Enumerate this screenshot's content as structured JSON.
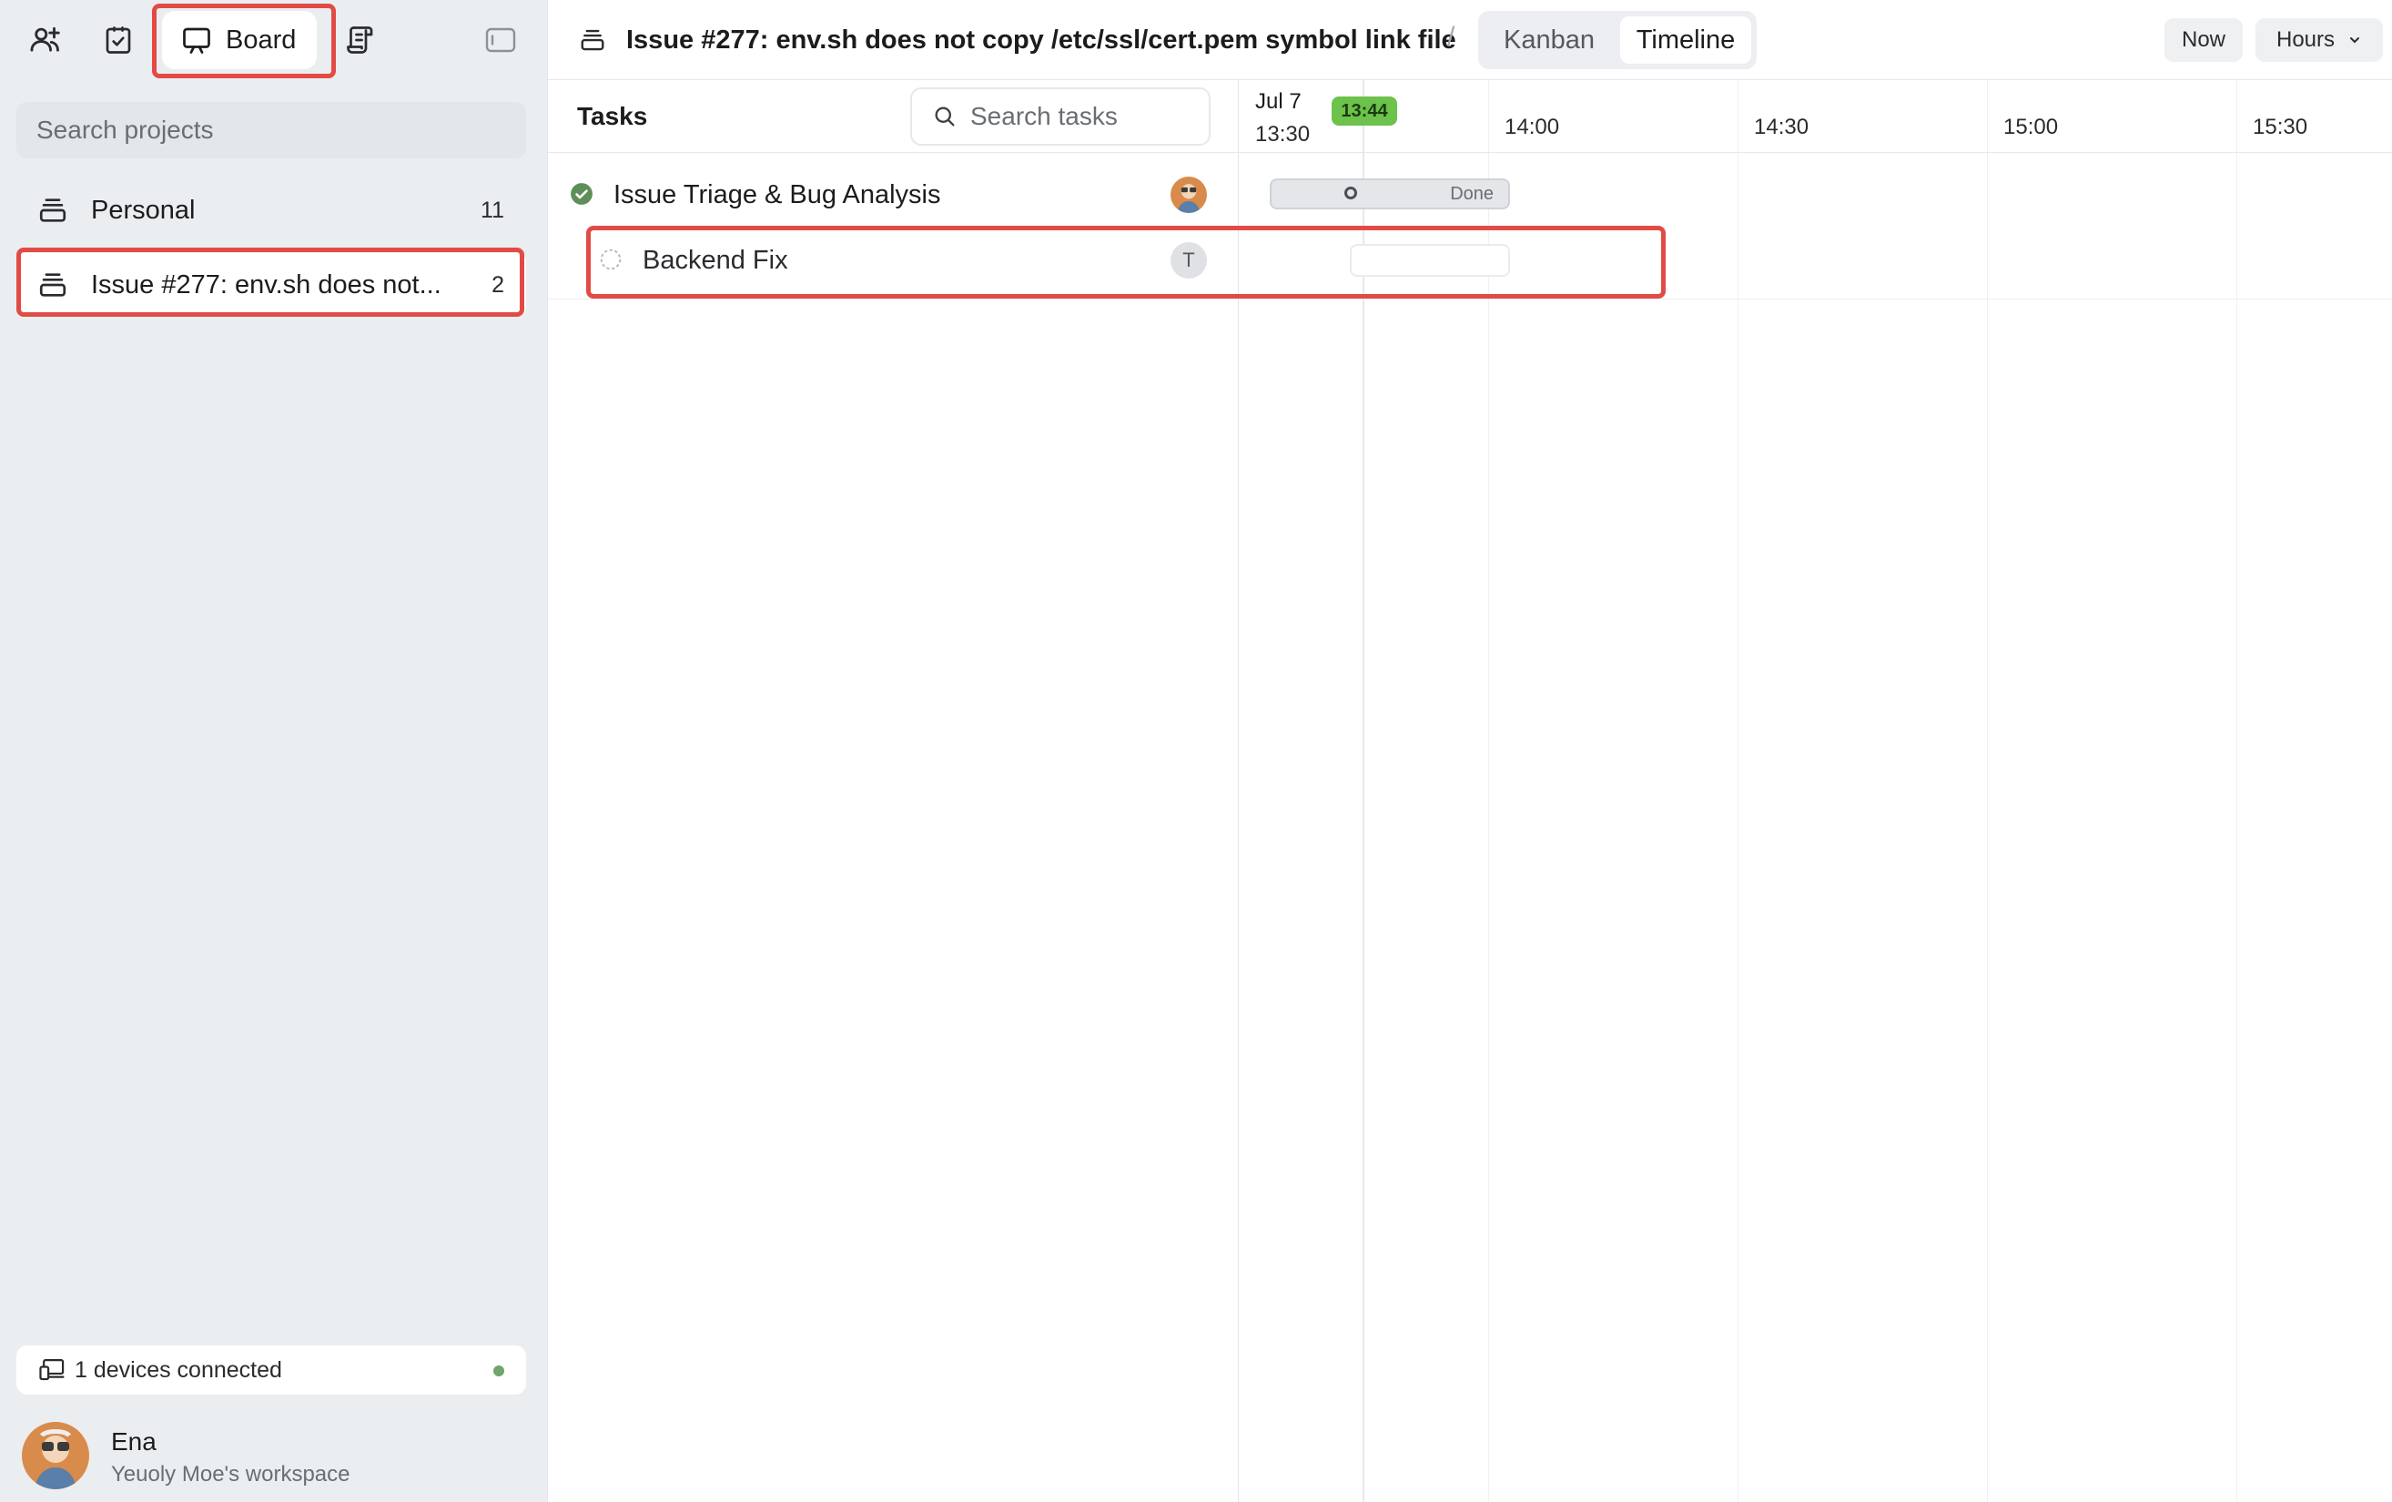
{
  "sidebar": {
    "top_icons": [
      "add-user-icon",
      "checklist-icon",
      "board-icon",
      "script-icon",
      "sidebar-toggle-icon"
    ],
    "board_label": "Board",
    "search_placeholder": "Search projects",
    "projects": [
      {
        "name": "Personal",
        "count": "11",
        "icon": "stack-icon"
      },
      {
        "name": "Issue #277: env.sh does not...",
        "count": "2",
        "icon": "stack-icon",
        "active": true
      }
    ],
    "devices_text": "1 devices connected",
    "devices_status_color": "#6ea56a",
    "user": {
      "name": "Ena",
      "workspace": "Yeuoly Moe's workspace"
    }
  },
  "header": {
    "project_title": "Issue #277: env.sh does not copy /etc/ssl/cert.pem symbol link file",
    "separator": "/",
    "tabs": [
      {
        "label": "Kanban",
        "active": false
      },
      {
        "label": "Timeline",
        "active": true
      }
    ],
    "now_label": "Now",
    "zoom_label": "Hours"
  },
  "tasks": {
    "title": "Tasks",
    "search_placeholder": "Search tasks",
    "rows": [
      {
        "name": "Issue Triage & Bug Analysis",
        "status": "done",
        "assignee": "avatar"
      },
      {
        "name": "Backend Fix",
        "status": "todo",
        "assignee_initial": "T"
      }
    ]
  },
  "timeline": {
    "date": "Jul 7",
    "ticks": [
      "13:30",
      "14:00",
      "14:30",
      "15:00",
      "15:30"
    ],
    "now_time": "13:44",
    "now_color": "#6cc24a",
    "bar_done_label": "Done"
  }
}
